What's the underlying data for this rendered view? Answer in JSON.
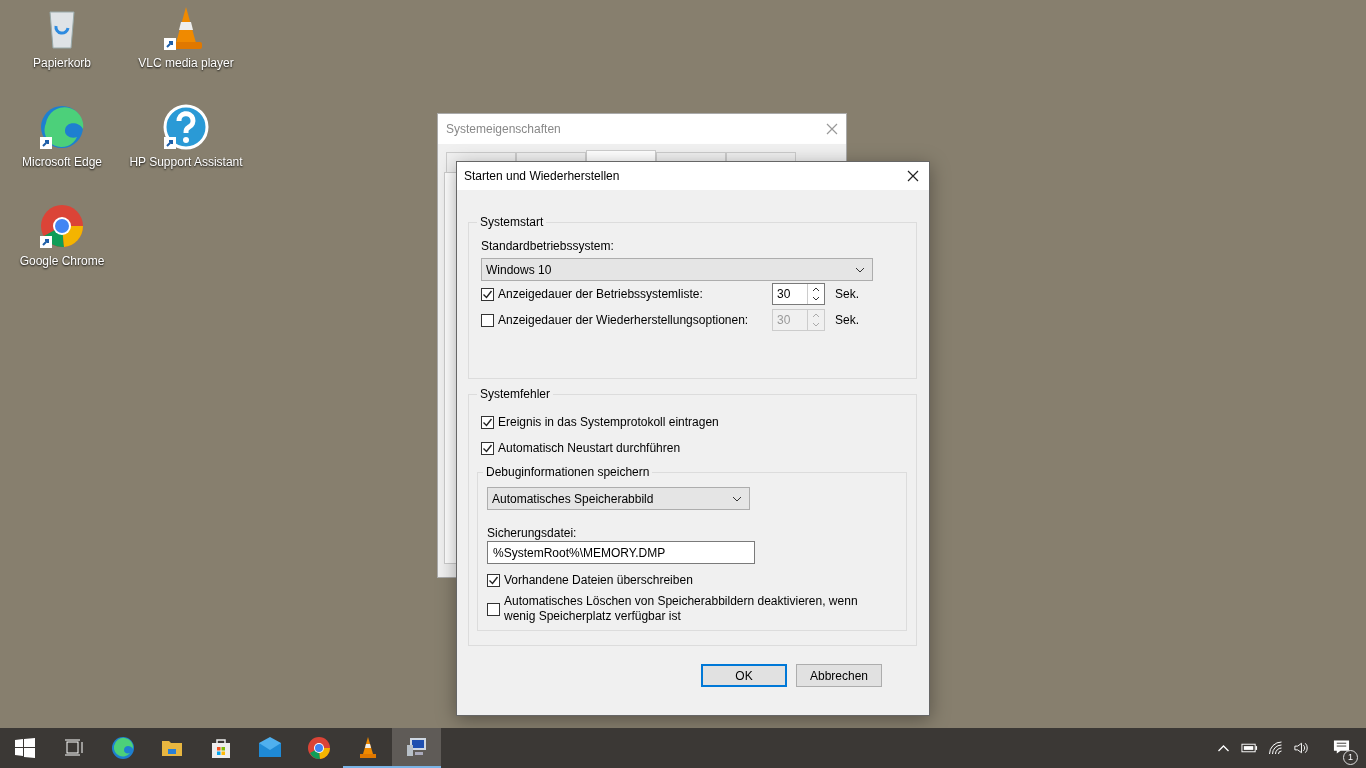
{
  "desktop_icons": [
    {
      "label": "Papierkorb",
      "kind": "recycle",
      "shortcut": false
    },
    {
      "label": "VLC media player",
      "kind": "cone",
      "shortcut": true
    },
    {
      "label": "Microsoft Edge",
      "kind": "edge",
      "shortcut": true
    },
    {
      "label": "HP Support Assistant",
      "kind": "help",
      "shortcut": true
    },
    {
      "label": "Google Chrome",
      "kind": "chrome",
      "shortcut": true
    }
  ],
  "back_window": {
    "title": "Systemeigenschaften",
    "tabs": [
      {
        "selected": false
      },
      {
        "selected": false
      },
      {
        "selected": true
      },
      {
        "selected": false
      },
      {
        "selected": false
      }
    ]
  },
  "dialog": {
    "title": "Starten und Wiederherstellen",
    "systemstart": {
      "legend": "Systemstart",
      "os_label": "Standardbetriebssystem:",
      "os_value": "Windows 10",
      "rows": [
        {
          "label": "Anzeigedauer der Betriebssystemliste:",
          "checked": true,
          "value": "30",
          "unit": "Sek."
        },
        {
          "label": "Anzeigedauer der Wiederherstellungsoptionen:",
          "checked": false,
          "value": "30",
          "unit": "Sek."
        }
      ]
    },
    "systemfehler": {
      "legend": "Systemfehler",
      "checks": [
        {
          "label": "Ereignis in das Systemprotokoll eintragen",
          "checked": true
        },
        {
          "label": "Automatisch Neustart durchführen",
          "checked": true
        }
      ],
      "debug": {
        "legend": "Debuginformationen speichern",
        "type_value": "Automatisches Speicherabbild",
        "file_label": "Sicherungsdatei:",
        "file_value": "%SystemRoot%\\MEMORY.DMP",
        "checks": [
          {
            "label": "Vorhandene Dateien überschreiben",
            "checked": true
          },
          {
            "label": "Automatisches Löschen von Speicherabbildern deaktivieren, wenn wenig Speicherplatz verfügbar ist",
            "checked": false
          }
        ]
      }
    },
    "buttons": [
      {
        "label": "OK",
        "kind": "default"
      },
      {
        "label": "Abbrechen",
        "kind": "normal"
      }
    ]
  },
  "taskbar": {
    "items": [
      {
        "kind": "start",
        "running": false,
        "selected": false
      },
      {
        "kind": "taskview",
        "running": false,
        "selected": false
      },
      {
        "kind": "edge",
        "running": false,
        "selected": false
      },
      {
        "kind": "folder",
        "running": false,
        "selected": false
      },
      {
        "kind": "store",
        "running": false,
        "selected": false
      },
      {
        "kind": "mail",
        "running": false,
        "selected": false
      },
      {
        "kind": "chrome",
        "running": false,
        "selected": false
      },
      {
        "kind": "cone",
        "running": true,
        "selected": false
      },
      {
        "kind": "monitor",
        "running": true,
        "selected": true
      }
    ],
    "notification_count": "1"
  }
}
